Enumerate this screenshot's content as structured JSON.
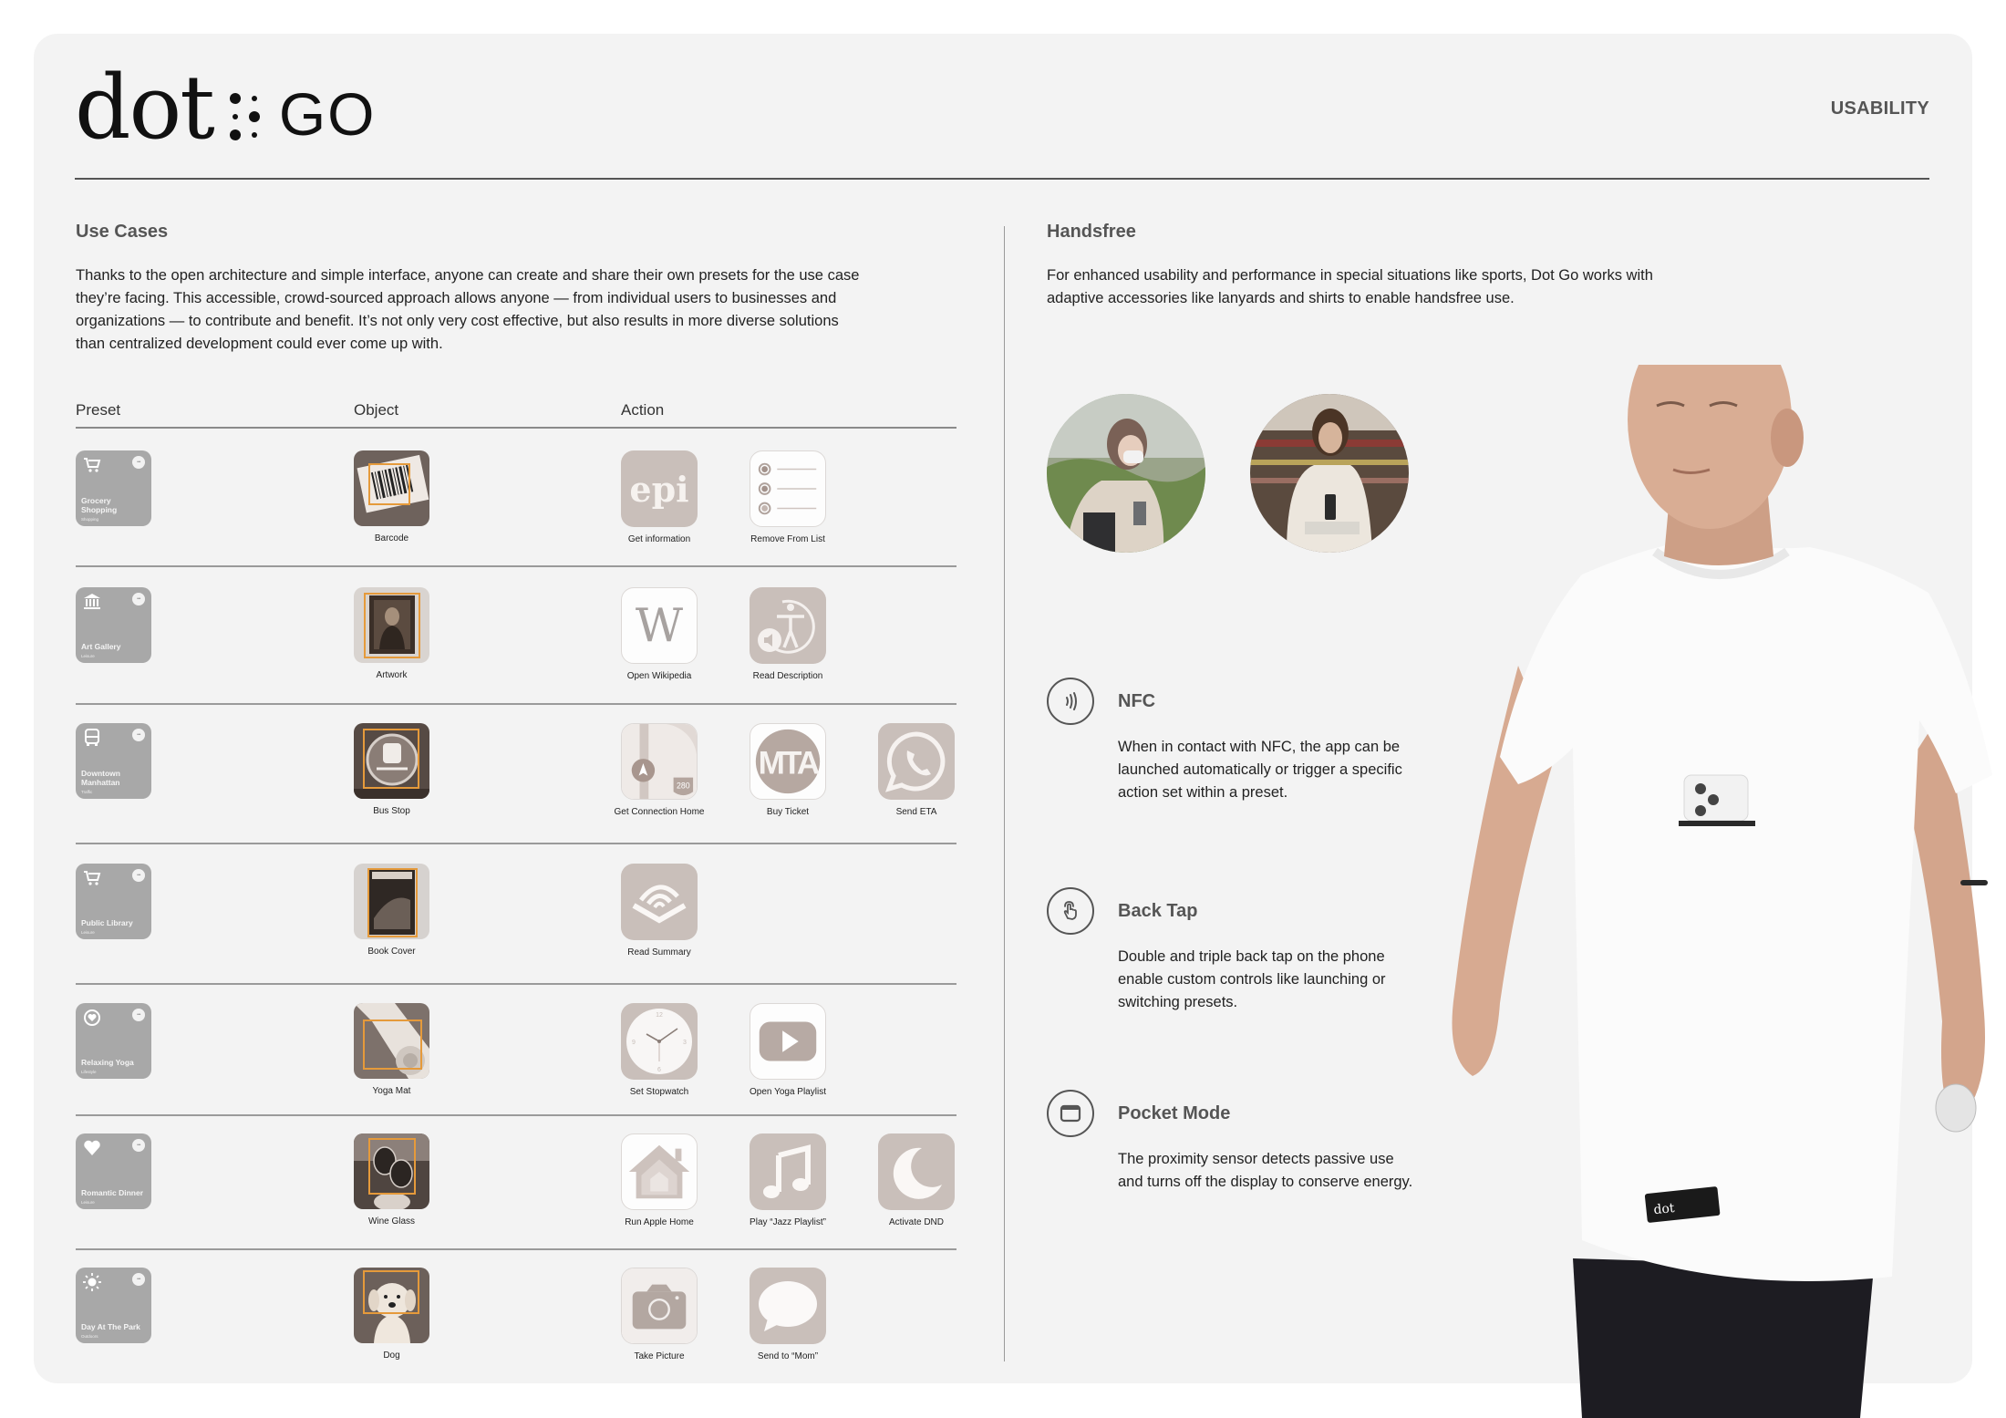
{
  "header": {
    "logo_word": "dot",
    "logo_product": "GO",
    "section_tag": "USABILITY"
  },
  "use_cases": {
    "title": "Use Cases",
    "body": "Thanks to the open architecture and simple interface, anyone can create and share their own presets for the use case they’re facing. This accessible, crowd-sourced approach allows anyone — from individual users to businesses and organizations — to contribute and benefit. It’s not only very cost effective, but also results in more diverse solutions than centralized development could ever come up with.",
    "columns": [
      "Preset",
      "Object",
      "Action"
    ],
    "rows": [
      {
        "preset": {
          "name": "Grocery Shopping",
          "category": "Shopping",
          "icon": "cart-icon"
        },
        "object": {
          "label": "Barcode",
          "icon": "barcode-photo"
        },
        "actions": [
          {
            "label": "Get information",
            "icon": "epi-app-icon"
          },
          {
            "label": "Remove From List",
            "icon": "reminders-app-icon"
          }
        ]
      },
      {
        "preset": {
          "name": "Art Gallery",
          "category": "Leisure",
          "icon": "museum-icon"
        },
        "object": {
          "label": "Artwork",
          "icon": "artwork-photo"
        },
        "actions": [
          {
            "label": "Open Wikipedia",
            "icon": "wikipedia-app-icon"
          },
          {
            "label": "Read Description",
            "icon": "accessibility-voiceover-icon"
          }
        ]
      },
      {
        "preset": {
          "name": "Downtown Manhattan",
          "category": "Traffic",
          "icon": "bus-icon"
        },
        "object": {
          "label": "Bus Stop",
          "icon": "bus-stop-photo"
        },
        "actions": [
          {
            "label": "Get Connection Home",
            "icon": "maps-app-icon"
          },
          {
            "label": "Buy Ticket",
            "icon": "mta-app-icon"
          },
          {
            "label": "Send ETA",
            "icon": "whatsapp-app-icon"
          }
        ]
      },
      {
        "preset": {
          "name": "Public Library",
          "category": "Leisure",
          "icon": "cart-icon"
        },
        "object": {
          "label": "Book Cover",
          "icon": "book-cover-photo"
        },
        "actions": [
          {
            "label": "Read Summary",
            "icon": "audible-app-icon"
          }
        ]
      },
      {
        "preset": {
          "name": "Relaxing Yoga",
          "category": "Lifestyle",
          "icon": "heart-circle-icon"
        },
        "object": {
          "label": "Yoga Mat",
          "icon": "yoga-mat-photo"
        },
        "actions": [
          {
            "label": "Set Stopwatch",
            "icon": "clock-app-icon"
          },
          {
            "label": "Open Yoga Playlist",
            "icon": "youtube-app-icon"
          }
        ]
      },
      {
        "preset": {
          "name": "Romantic Dinner",
          "category": "Leisure",
          "icon": "heart-icon"
        },
        "object": {
          "label": "Wine Glass",
          "icon": "wine-glass-photo"
        },
        "actions": [
          {
            "label": "Run Apple Home",
            "icon": "home-app-icon"
          },
          {
            "label": "Play “Jazz Playlist”",
            "icon": "music-app-icon"
          },
          {
            "label": "Activate DND",
            "icon": "moon-icon"
          }
        ]
      },
      {
        "preset": {
          "name": "Day At The Park",
          "category": "Outdoors",
          "icon": "sun-icon"
        },
        "object": {
          "label": "Dog",
          "icon": "dog-photo"
        },
        "actions": [
          {
            "label": "Take Picture",
            "icon": "camera-app-icon"
          },
          {
            "label": "Send to “Mom”",
            "icon": "messages-app-icon"
          }
        ]
      }
    ]
  },
  "handsfree": {
    "title": "Handsfree",
    "body": "For enhanced usability and performance in special situations like sports, Dot Go works with adaptive accessories like lanyards and shirts to enable handsfree use.",
    "photos": [
      "woman-with-lanyard-outdoors",
      "woman-with-lanyard-in-store"
    ],
    "features": [
      {
        "title": "NFC",
        "icon": "nfc-icon",
        "desc": "When in contact with NFC, the app can be launched automatically or trigger a specific action set within a preset."
      },
      {
        "title": "Back Tap",
        "icon": "tap-hand-icon",
        "desc": "Double and triple back tap on the phone enable custom controls like launching or switching presets."
      },
      {
        "title": "Pocket Mode",
        "icon": "window-icon",
        "desc": "The proximity sensor detects passive use and turns off the display to conserve energy."
      }
    ],
    "hero_photo": "man-in-white-shirt-with-phone-pocket",
    "shirt_label": "dot"
  },
  "colors": {
    "card_bg": "#f3f3f3",
    "preset_bg": "#a8a8a8",
    "action_taupe": "#c9bfba",
    "object_frame": "#e59a3b",
    "heading_gray": "#555555"
  }
}
